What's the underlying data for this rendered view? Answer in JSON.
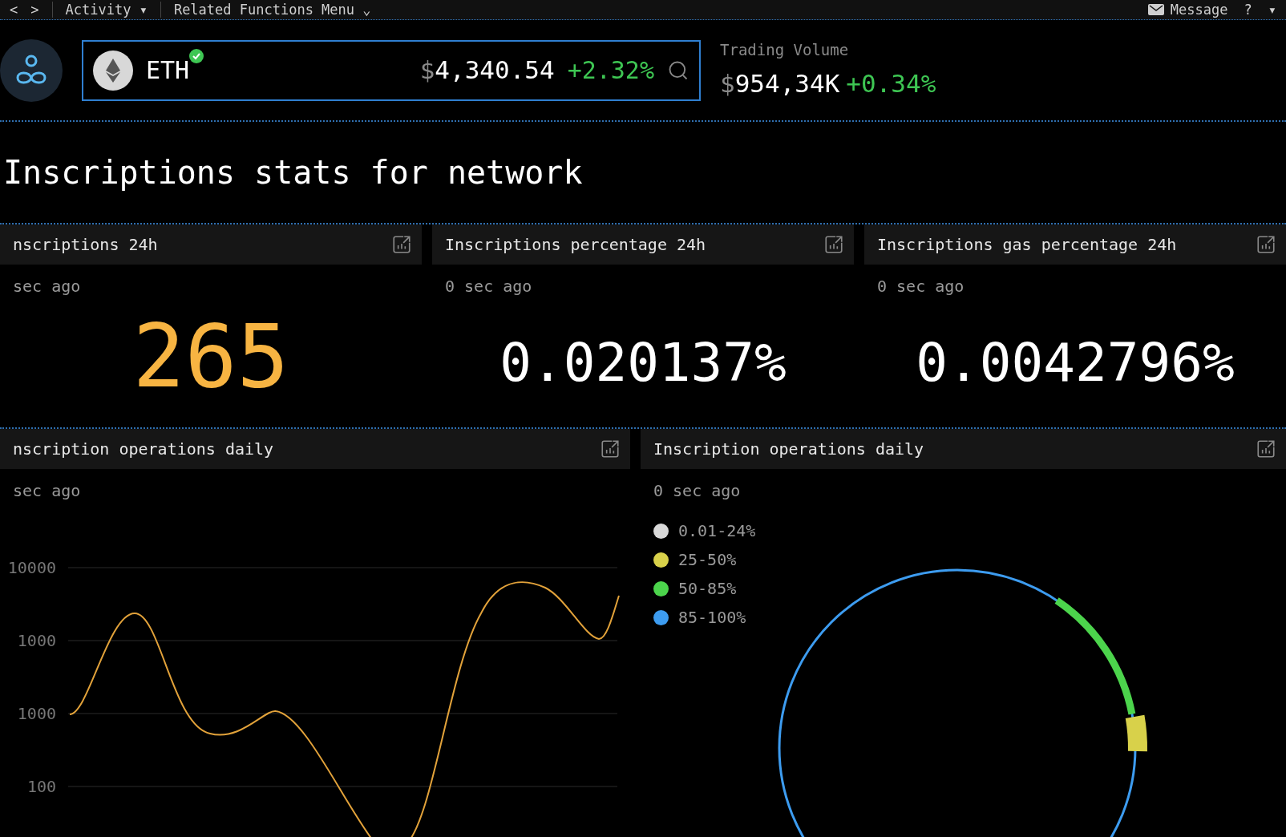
{
  "top_bar": {
    "nav": [
      "<",
      ">"
    ],
    "menus": [
      {
        "label": "Activity",
        "caret": "▾"
      },
      {
        "label": "Related Functions Menu",
        "caret": "⌄"
      }
    ],
    "message": "Message",
    "help": "?",
    "caret": "▾"
  },
  "token_search": {
    "symbol": "ETH",
    "verified": true,
    "currency": "$",
    "price": "4,340.54",
    "change": "+2.32%"
  },
  "trading_volume": {
    "label": "Trading Volume",
    "currency": "$",
    "value": "954,34K",
    "change": "+0.34%"
  },
  "title": "Inscriptions stats for network",
  "stat_cards": [
    {
      "title": "nscriptions 24h",
      "updated": "sec ago",
      "value": "265",
      "highlight": true
    },
    {
      "title": "Inscriptions percentage 24h",
      "updated": "0 sec ago",
      "value": "0.020137%",
      "highlight": false
    },
    {
      "title": "Inscriptions gas percentage 24h",
      "updated": "0 sec ago",
      "value": "0.0042796%",
      "highlight": false
    }
  ],
  "line_card": {
    "title": "nscription operations daily",
    "updated": "sec ago",
    "y_axis_labels": [
      "10000",
      "1000",
      "1000",
      "100"
    ]
  },
  "donut_card": {
    "title": "Inscription operations daily",
    "updated": "0 sec ago",
    "legend": [
      {
        "label": "0.01-24%",
        "color": "#d9d9d9"
      },
      {
        "label": "25-50%",
        "color": "#d8d14a"
      },
      {
        "label": "50-85%",
        "color": "#4cd44c"
      },
      {
        "label": "85-100%",
        "color": "#3d9cf0"
      }
    ]
  }
}
